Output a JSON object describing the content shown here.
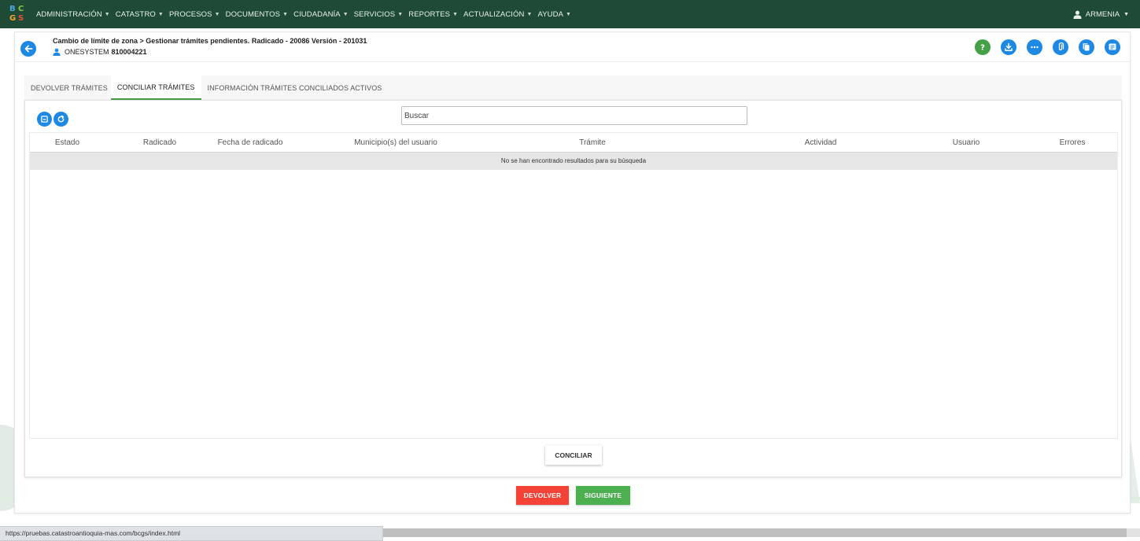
{
  "logo": {
    "letters": [
      "B",
      "C",
      "G",
      "S"
    ]
  },
  "nav": {
    "items": [
      "ADMINISTRACIÓN",
      "CATASTRO",
      "PROCESOS",
      "DOCUMENTOS",
      "CIUDADANÍA",
      "SERVICIOS",
      "REPORTES",
      "ACTUALIZACIÓN",
      "AYUDA"
    ],
    "user": "ARMENIA"
  },
  "header": {
    "title": "Cambio de límite de zona > Gestionar trámites pendientes. Radicado - 20086 Versión - 201031",
    "user_name": "ONESYSTEM",
    "user_id": "810004221"
  },
  "actions": [
    "help-icon",
    "download-icon",
    "more-icon",
    "attachment-icon",
    "copy-icon",
    "notes-icon"
  ],
  "tabs": [
    {
      "label": "DEVOLVER TRÁMITES",
      "active": false
    },
    {
      "label": "CONCILIAR TRÁMITES",
      "active": true
    },
    {
      "label": "INFORMACIÓN TRÁMITES CONCILIADOS ACTIVOS",
      "active": false
    }
  ],
  "search": {
    "placeholder": "Buscar",
    "value": ""
  },
  "table": {
    "columns": [
      "Estado",
      "Radicado",
      "Fecha de radicado",
      "Municipio(s) del usuario",
      "Trámite",
      "Actividad",
      "Usuario",
      "Errores"
    ],
    "empty_message": "No se han encontrado resultados para su búsqueda"
  },
  "buttons": {
    "conciliar": "CONCILIAR",
    "devolver": "DEVOLVER",
    "siguiente": "SIGUIENTE"
  },
  "status_bar": {
    "url": "https://pruebas.catastroantioquia-mas.com/bcgs/index.html"
  },
  "colors": {
    "nav_bg": "#1f4b36",
    "accent_blue": "#1e88e5",
    "tab_active": "#43a047",
    "danger": "#f44336",
    "success": "#4caf50"
  }
}
